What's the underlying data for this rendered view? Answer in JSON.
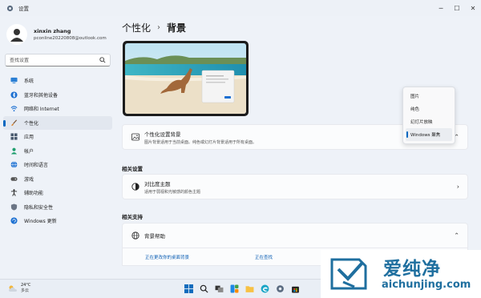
{
  "window": {
    "title": "设置",
    "controls": [
      "minimize-icon",
      "maximize-icon",
      "close-icon"
    ]
  },
  "user": {
    "name": "xinxin zhang",
    "email": "pconline20220808@outlook.com"
  },
  "search": {
    "placeholder": "查找设置",
    "icon": "search-icon"
  },
  "sidebar": {
    "items": [
      {
        "label": "系统",
        "icon": "system-icon"
      },
      {
        "label": "蓝牙和其他设备",
        "icon": "bluetooth-icon"
      },
      {
        "label": "网络和 Internet",
        "icon": "wifi-icon"
      },
      {
        "label": "个性化",
        "icon": "brush-icon",
        "active": true
      },
      {
        "label": "应用",
        "icon": "apps-icon"
      },
      {
        "label": "帐户",
        "icon": "account-icon"
      },
      {
        "label": "时间和语言",
        "icon": "globe-icon"
      },
      {
        "label": "游戏",
        "icon": "gamepad-icon"
      },
      {
        "label": "辅助功能",
        "icon": "accessibility-icon"
      },
      {
        "label": "隐私和安全性",
        "icon": "shield-icon"
      },
      {
        "label": "Windows 更新",
        "icon": "update-icon"
      }
    ]
  },
  "breadcrumb": {
    "parent": "个性化",
    "separator": "›",
    "current": "背景"
  },
  "personalize_background": {
    "title": "个性化设置背景",
    "description": "图片背景适用于当前桌面。纯色或幻灯片背景适用于所有桌面。",
    "options": [
      "图片",
      "纯色",
      "幻灯片放映",
      "Windows 聚焦"
    ],
    "selected": "Windows 聚焦"
  },
  "related_settings": {
    "heading": "相关设置",
    "contrast": {
      "title": "对比度主题",
      "description": "适用于弱视和光敏感的颜色主题"
    }
  },
  "related_support": {
    "heading": "相关支持",
    "help_title": "背景帮助",
    "links": [
      "正在更改你的桌面背景",
      "正在查找"
    ]
  },
  "taskbar": {
    "weather": {
      "temp": "24°C",
      "condition": "多云"
    },
    "icons": [
      "windows-start-icon",
      "search-icon",
      "task-view-icon",
      "widgets-icon",
      "file-explorer-icon",
      "edge-icon",
      "settings-icon",
      "store-icon"
    ]
  },
  "watermark": {
    "text_cn": "爱纯净",
    "text_en": "aichunjing.com"
  },
  "colors": {
    "accent": "#0067c0",
    "link": "#0a5db3",
    "window_bg": "#eef2f8",
    "card_bg": "#fbfcfd",
    "watermark": "#1f6f9f"
  }
}
